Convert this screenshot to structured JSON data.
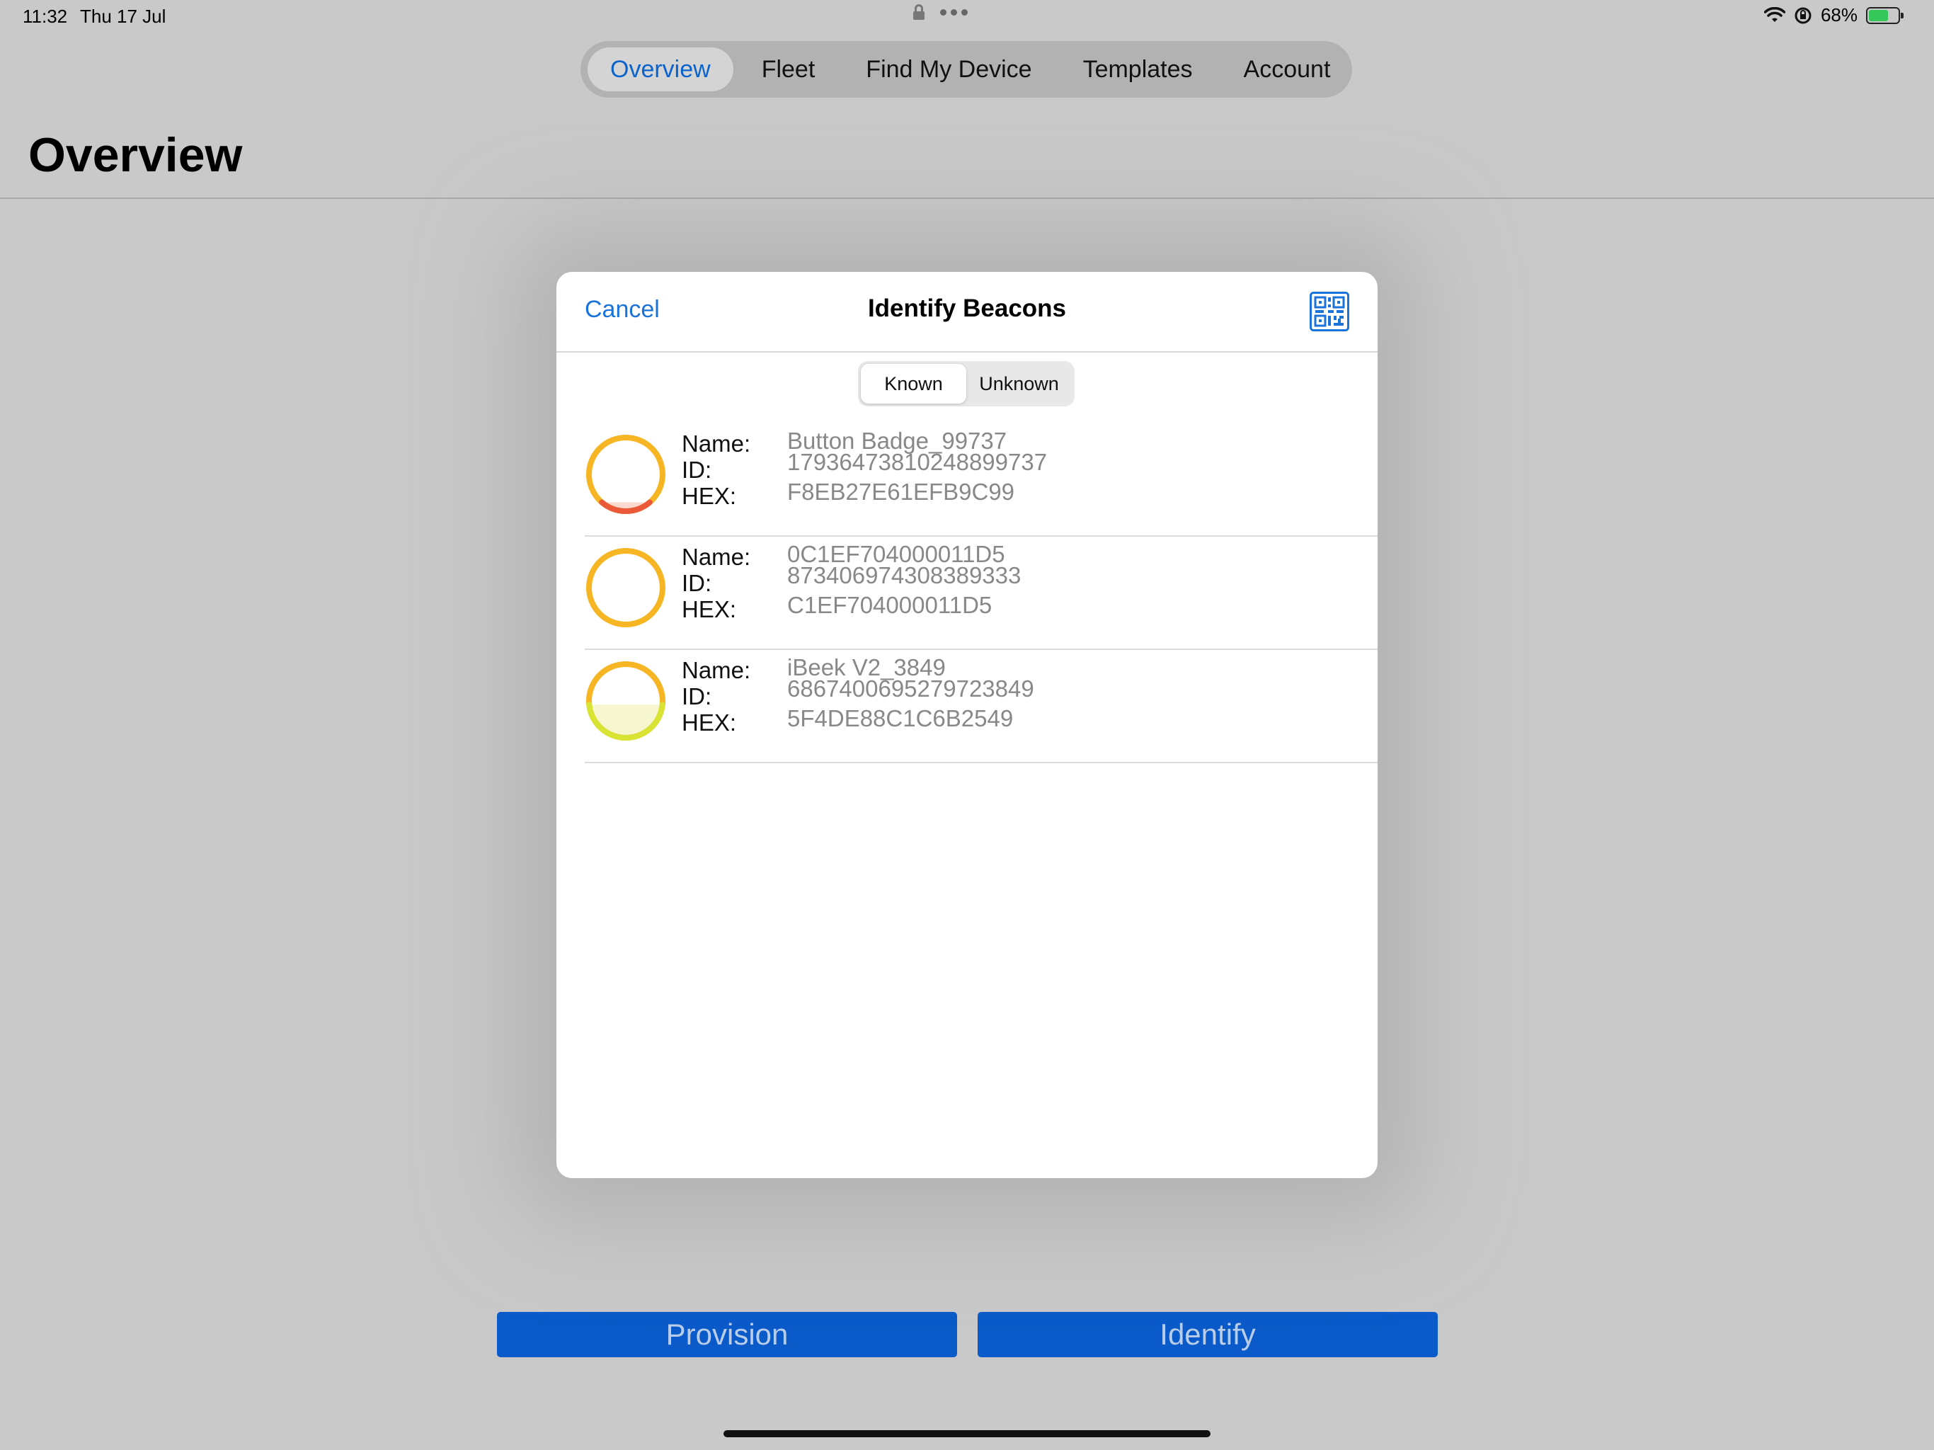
{
  "status_bar": {
    "time": "11:32",
    "date": "Thu 17 Jul",
    "battery": "68%",
    "battery_level": 0.68,
    "icons": [
      "lock-icon",
      "more-dots-icon",
      "wifi-icon",
      "rotation-lock-icon",
      "battery-charging-icon"
    ]
  },
  "tabs": [
    {
      "label": "Overview",
      "active": true
    },
    {
      "label": "Fleet",
      "active": false
    },
    {
      "label": "Find My Device",
      "active": false
    },
    {
      "label": "Templates",
      "active": false
    },
    {
      "label": "Account",
      "active": false
    }
  ],
  "page_title": "Overview",
  "modal": {
    "cancel_label": "Cancel",
    "title": "Identify Beacons",
    "qr_icon": "qr-code-icon",
    "segments": [
      {
        "label": "Known",
        "active": true
      },
      {
        "label": "Unknown",
        "active": false
      }
    ],
    "field_labels": {
      "name": "Name:",
      "id": "ID:",
      "hex": "HEX:"
    },
    "beacons": [
      {
        "name": "Button Badge_99737",
        "id": "17936473810248899737",
        "hex": "F8EB27E61EFB9C99",
        "level": 0.12,
        "level_color": "#e9593a",
        "fill_color": "#fbd9d0"
      },
      {
        "name": "0C1EF704000011D5",
        "id": "873406974308389333",
        "hex": "C1EF704000011D5",
        "level": 0.0,
        "level_color": "#f6b522",
        "fill_color": "#ffffff"
      },
      {
        "name": "iBeek V2_3849",
        "id": "6867400695279723849",
        "hex": "5F4DE88C1C6B2549",
        "level": 0.45,
        "level_color": "#d8e333",
        "fill_color": "#f6f7cf"
      }
    ]
  },
  "buttons": {
    "provision": "Provision",
    "identify": "Identify"
  },
  "colors": {
    "accent": "#1a73d9",
    "gauge_ring": "#f6b522",
    "button_bg": "#0a5ac9"
  }
}
